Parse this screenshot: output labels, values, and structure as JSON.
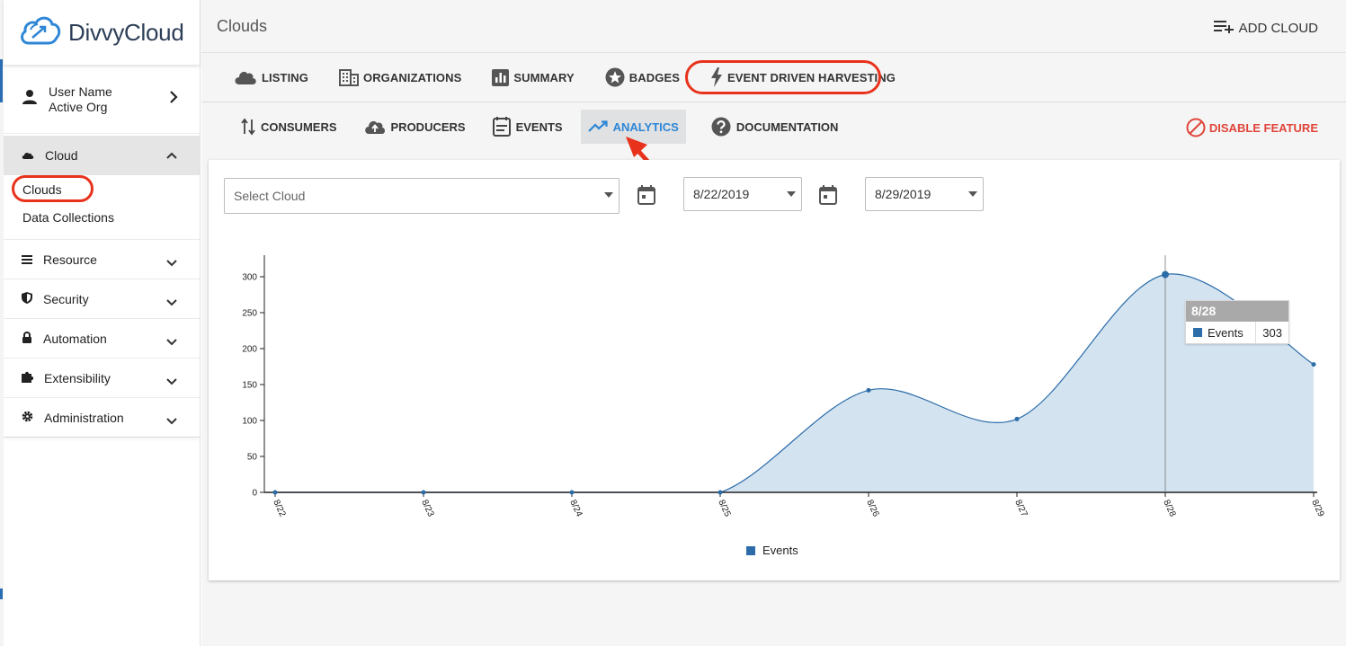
{
  "brand": {
    "name": "DivvyCloud"
  },
  "user": {
    "name": "User Name",
    "org": "Active Org"
  },
  "sidebar": {
    "section": {
      "label": "Cloud",
      "items": [
        "Clouds",
        "Data Collections"
      ]
    },
    "groups": [
      {
        "label": "Resource",
        "icon": "list-icon"
      },
      {
        "label": "Security",
        "icon": "shield-icon"
      },
      {
        "label": "Automation",
        "icon": "lock-icon"
      },
      {
        "label": "Extensibility",
        "icon": "puzzle-icon"
      },
      {
        "label": "Administration",
        "icon": "gear-icon"
      }
    ]
  },
  "header": {
    "title": "Clouds",
    "add_cloud": "ADD CLOUD"
  },
  "tabs": [
    {
      "label": "LISTING",
      "icon": "cloud-icon"
    },
    {
      "label": "ORGANIZATIONS",
      "icon": "building-icon"
    },
    {
      "label": "SUMMARY",
      "icon": "bar-chart-icon"
    },
    {
      "label": "BADGES",
      "icon": "star-badge-icon"
    },
    {
      "label": "EVENT DRIVEN HARVESTING",
      "icon": "lightning-icon"
    }
  ],
  "subtabs": [
    {
      "label": "CONSUMERS",
      "icon": "arrows-updown-icon"
    },
    {
      "label": "PRODUCERS",
      "icon": "cloud-upload-icon"
    },
    {
      "label": "EVENTS",
      "icon": "document-icon"
    },
    {
      "label": "ANALYTICS",
      "icon": "trending-up-icon",
      "active": true
    },
    {
      "label": "DOCUMENTATION",
      "icon": "help-circle-icon"
    }
  ],
  "disable_feature": "DISABLE FEATURE",
  "filters": {
    "cloud_placeholder": "Select Cloud",
    "start_date": "8/22/2019",
    "end_date": "8/29/2019"
  },
  "colors": {
    "accent": "#2e86d6",
    "series": "#2b6ca9",
    "area": "#d4e3f0",
    "danger": "#e0443a",
    "annotation": "#e8321c"
  },
  "chart_data": {
    "type": "area",
    "x": [
      "8/22",
      "8/23",
      "8/24",
      "8/25",
      "8/26",
      "8/27",
      "8/28",
      "8/29"
    ],
    "series": [
      {
        "name": "Events",
        "values": [
          0,
          0,
          0,
          0,
          142,
          102,
          303,
          178
        ]
      }
    ],
    "yticks": [
      0,
      50,
      100,
      150,
      200,
      250,
      300
    ],
    "ylim": [
      0,
      330
    ],
    "legend": "bottom-center",
    "grid": false,
    "tooltip": {
      "x": "8/28",
      "series": "Events",
      "value": "303"
    }
  }
}
